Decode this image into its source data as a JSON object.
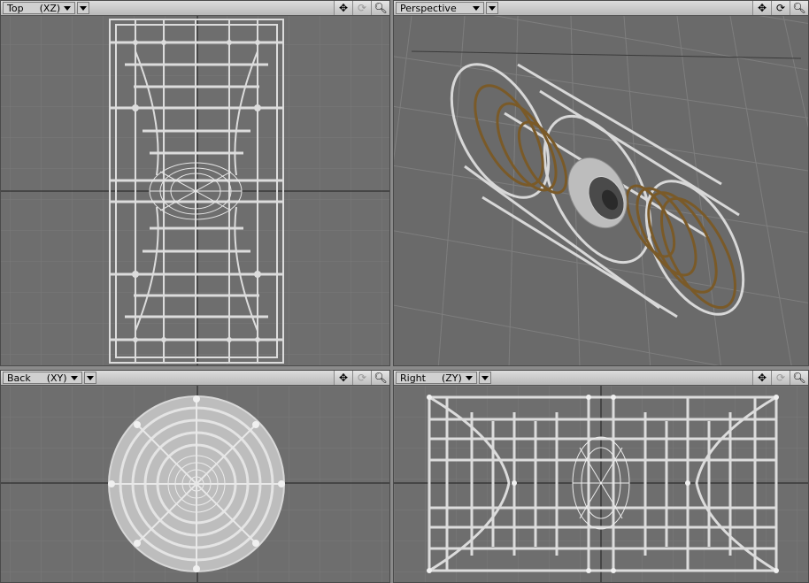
{
  "viewports": {
    "top": {
      "view_label": "Top",
      "axis_label": "(XZ)"
    },
    "perspective": {
      "view_label": "Perspective",
      "axis_label": ""
    },
    "back": {
      "view_label": "Back",
      "axis_label": "(XY)"
    },
    "right": {
      "view_label": "Right",
      "axis_label": "(ZY)"
    }
  },
  "icons": {
    "move": "four-way-arrow-icon",
    "rotate": "rotate-icon",
    "zoom": "magnifier-icon"
  },
  "colors": {
    "viewport_background": "#6e6e6e",
    "grid": "#7a7a7a",
    "wireframe": "#dcdcdc",
    "rings": "#7a5a28",
    "axis_line": "#1e1e1e",
    "header": "#c8c8c8"
  }
}
